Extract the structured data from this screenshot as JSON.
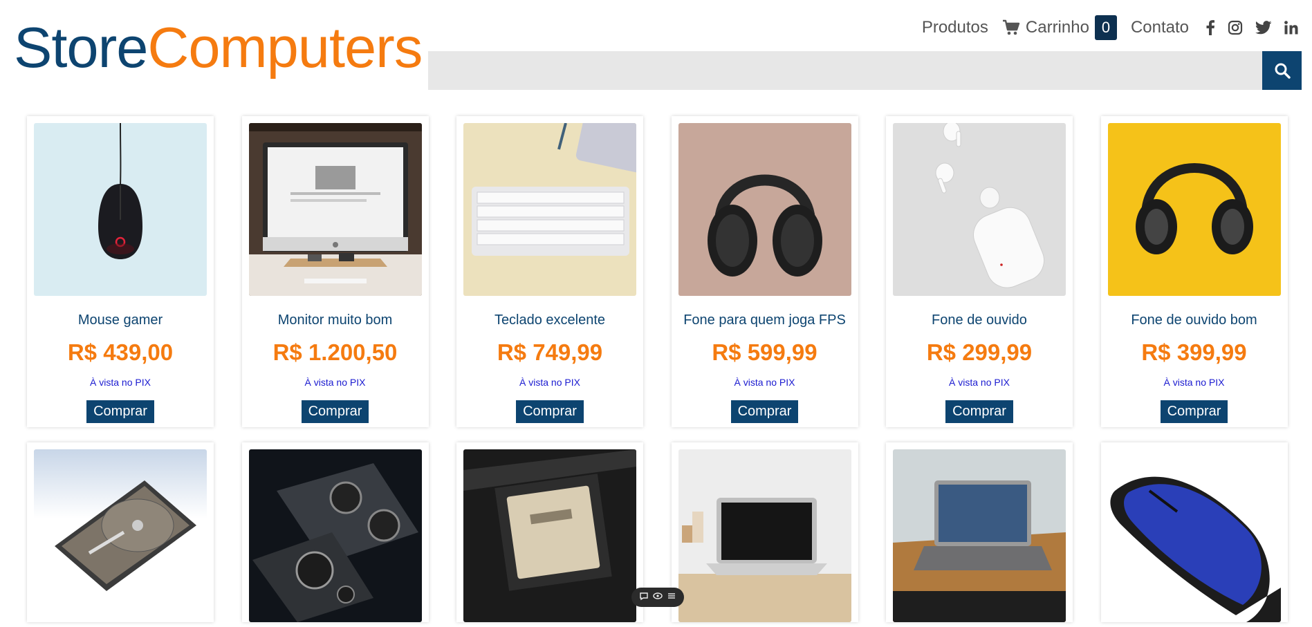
{
  "brand": {
    "part1": "Store",
    "part2": "Computers",
    "colors": {
      "primary": "#0d4470",
      "accent": "#f57b10"
    }
  },
  "nav": {
    "produtos": "Produtos",
    "carrinho": "Carrinho",
    "cart_count": "0",
    "contato": "Contato",
    "social_icons": [
      "facebook-icon",
      "instagram-icon",
      "twitter-icon",
      "linkedin-icon"
    ]
  },
  "search": {
    "value": "",
    "placeholder": "",
    "button_icon": "search-icon"
  },
  "products": [
    {
      "name": "Mouse gamer",
      "price": "R$ 439,00",
      "note": "À vista no PIX",
      "button": "Comprar",
      "image": "black gaming mouse on light blue background"
    },
    {
      "name": "Monitor muito bom",
      "price": "R$ 1.200,50",
      "note": "À vista no PIX",
      "button": "Comprar",
      "image": "desktop monitor on wooden stand"
    },
    {
      "name": "Teclado excelente",
      "price": "R$ 749,99",
      "note": "À vista no PIX",
      "button": "Comprar",
      "image": "white keyboard on beige background"
    },
    {
      "name": "Fone para quem joga FPS",
      "price": "R$ 599,99",
      "note": "À vista no PIX",
      "button": "Comprar",
      "image": "black over-ear headphones on pink background"
    },
    {
      "name": "Fone de ouvido",
      "price": "R$ 299,99",
      "note": "À vista no PIX",
      "button": "Comprar",
      "image": "white wireless earbuds with case"
    },
    {
      "name": "Fone de ouvido bom",
      "price": "R$ 399,99",
      "note": "À vista no PIX",
      "button": "Comprar",
      "image": "black headphones on yellow background"
    }
  ],
  "products_row2_images": [
    "hard disk drive",
    "graphics cards",
    "Ryzen processor",
    "laptop on wooden desk",
    "laptop on wooden table",
    "blue computer mouse"
  ],
  "toolbar_icons": [
    "comment-icon",
    "eye-icon",
    "menu-icon"
  ]
}
